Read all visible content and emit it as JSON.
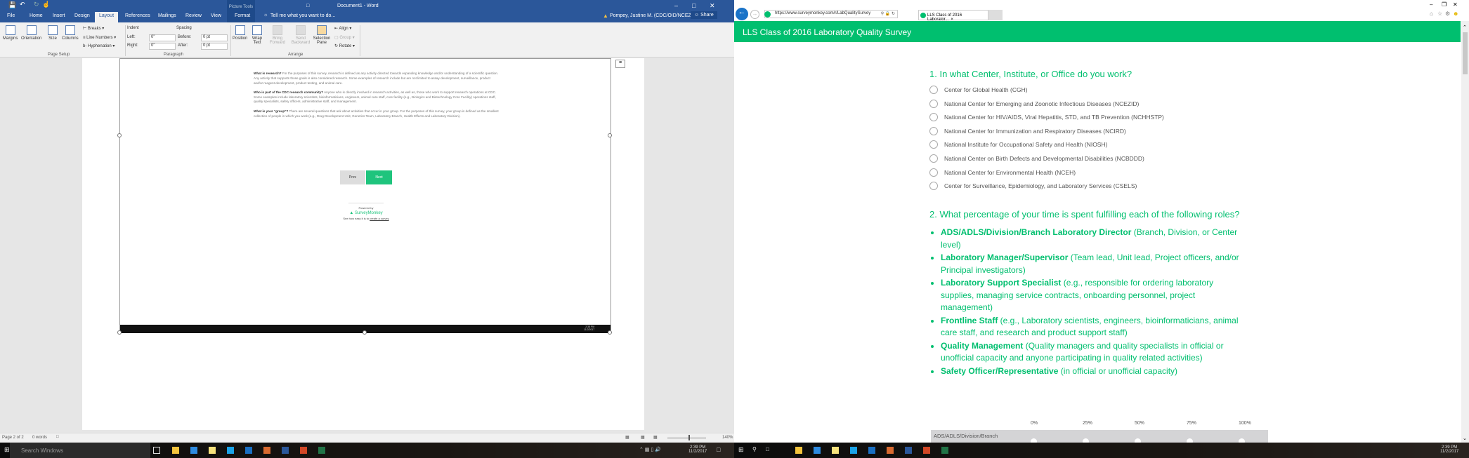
{
  "word": {
    "title": "Document1 - Word",
    "contextual_tab_group": "Picture Tools",
    "tabs": [
      "File",
      "Home",
      "Insert",
      "Design",
      "Layout",
      "References",
      "Mailings",
      "Review",
      "View",
      "Format"
    ],
    "active_tab": "Layout",
    "tell_me": "Tell me what you want to do...",
    "user": "Pompey, Justine M. (CDC/OID/NCEZID)",
    "share": "Share",
    "ribbon": {
      "margins": "Margins",
      "orientation": "Orientation",
      "size": "Size",
      "columns": "Columns",
      "breaks": "Breaks",
      "line_numbers": "Line Numbers",
      "hyphenation": "Hyphenation",
      "page_setup": "Page Setup",
      "indent": "Indent",
      "left": "Left:",
      "right": "Right:",
      "left_val": "0\"",
      "right_val": "0\"",
      "spacing": "Spacing",
      "before": "Before:",
      "after": "After:",
      "before_val": "0 pt",
      "after_val": "0 pt",
      "paragraph": "Paragraph",
      "position": "Position",
      "wrap_text": "Wrap Text",
      "bring_forward": "Bring Forward",
      "send_backward": "Send Backward",
      "selection_pane": "Selection Pane",
      "align": "Align",
      "group": "Group",
      "rotate": "Rotate",
      "arrange": "Arrange"
    },
    "doc": {
      "p1_bold": "What is research?",
      "p1": " For the purposes of this survey, research is defined as any activity directed towards expanding knowledge and/or understanding of a scientific question.  Any activity that supports those goals is also considered research.  Some examples of research include but are not limited to assay development, surveillance, product and/or reagent development, product testing, and animal care.",
      "p2_bold": "Who is part of the CDC research community?",
      "p2": "  Anyone who is directly involved in research activities, as well as, those who work to support research operations at CDC.  Some examples include laboratory scientists, bioinformaticians, engineers, animal care staff, core facility (e.g., Biologics and Biotechnology Core Facility) operations staff, quality specialists, safety officers, administrative staff, and management.",
      "p3_bold": "What is your “group”?",
      "p3": "  There are several questions that ask about activities that occur in your group.  For the purposes of this survey, your group is defined as the smallest collection of people in which you work (e.g., Drug Development Unit, Genetics Team, Laboratory Branch, Health Effects and Laboratory Division).",
      "prev": "Prev",
      "next": "Next",
      "powered_by": "Powered by",
      "brand": "SurveyMonkey",
      "create_prefix": "See how easy it is to ",
      "create_link": "create a survey",
      "mini_time": "2:38 PM",
      "mini_date": "11/2/2017"
    },
    "status": {
      "page": "Page 2 of 2",
      "words": "0 words",
      "zoom": "140%"
    }
  },
  "browser": {
    "url": "https://www.surveymonkey.com/r/LabQualitySurvey",
    "tab": "LLS Class of 2016 Laborator...",
    "header": "LLS Class of 2016 Laboratory Quality Survey",
    "q1": "1. In what Center, Institute, or Office do you work?",
    "q1_options": [
      "Center for Global Health (CGH)",
      "National Center for Emerging and Zoonotic Infectious Diseases (NCEZID)",
      "National Center for HIV/AIDS, Viral Hepatitis, STD, and TB Prevention (NCHHSTP)",
      "National Center for Immunization and Respiratory Diseases (NCIRD)",
      "National Institute for Occupational Safety and Health (NIOSH)",
      "National Center on Birth Defects and Developmental Disabilities (NCBDDD)",
      "National Center for Environmental Health (NCEH)",
      "Center for Surveillance, Epidemiology, and Laboratory Services (CSELS)"
    ],
    "q2": "2. What percentage of your time is spent fulfilling each of the following roles?",
    "roles": [
      {
        "title": "ADS/ADLS/Division/Branch Laboratory Director",
        "desc": " (Branch, Division, or Center level)"
      },
      {
        "title": "Laboratory Manager/Supervisor",
        "desc": " (Team lead, Unit lead, Project officers, and/or Principal investigators)"
      },
      {
        "title": "Laboratory Support Specialist",
        "desc": " (e.g., responsible for ordering laboratory supplies, managing service contracts, onboarding personnel, project management)"
      },
      {
        "title": "Frontline Staff",
        "desc": " (e.g., Laboratory scientists, engineers, bioinformaticians, animal care staff, and research and product support staff)"
      },
      {
        "title": "Quality Management",
        "desc": " (Quality managers and quality specialists in official or unofficial capacity and anyone participating in quality related activities)"
      },
      {
        "title": "Safety Officer/Representative",
        "desc": " (in official or unofficial capacity)"
      }
    ],
    "matrix_cols": [
      "0%",
      "25%",
      "50%",
      "75%",
      "100%"
    ],
    "matrix_row": "ADS/ADLS/Division/Branch"
  },
  "taskbar": {
    "search": "Search Windows",
    "time": "2:39 PM",
    "date": "11/2/2017"
  },
  "colors": {
    "word_blue": "#2b579a",
    "survey_green": "#00bf6f"
  }
}
